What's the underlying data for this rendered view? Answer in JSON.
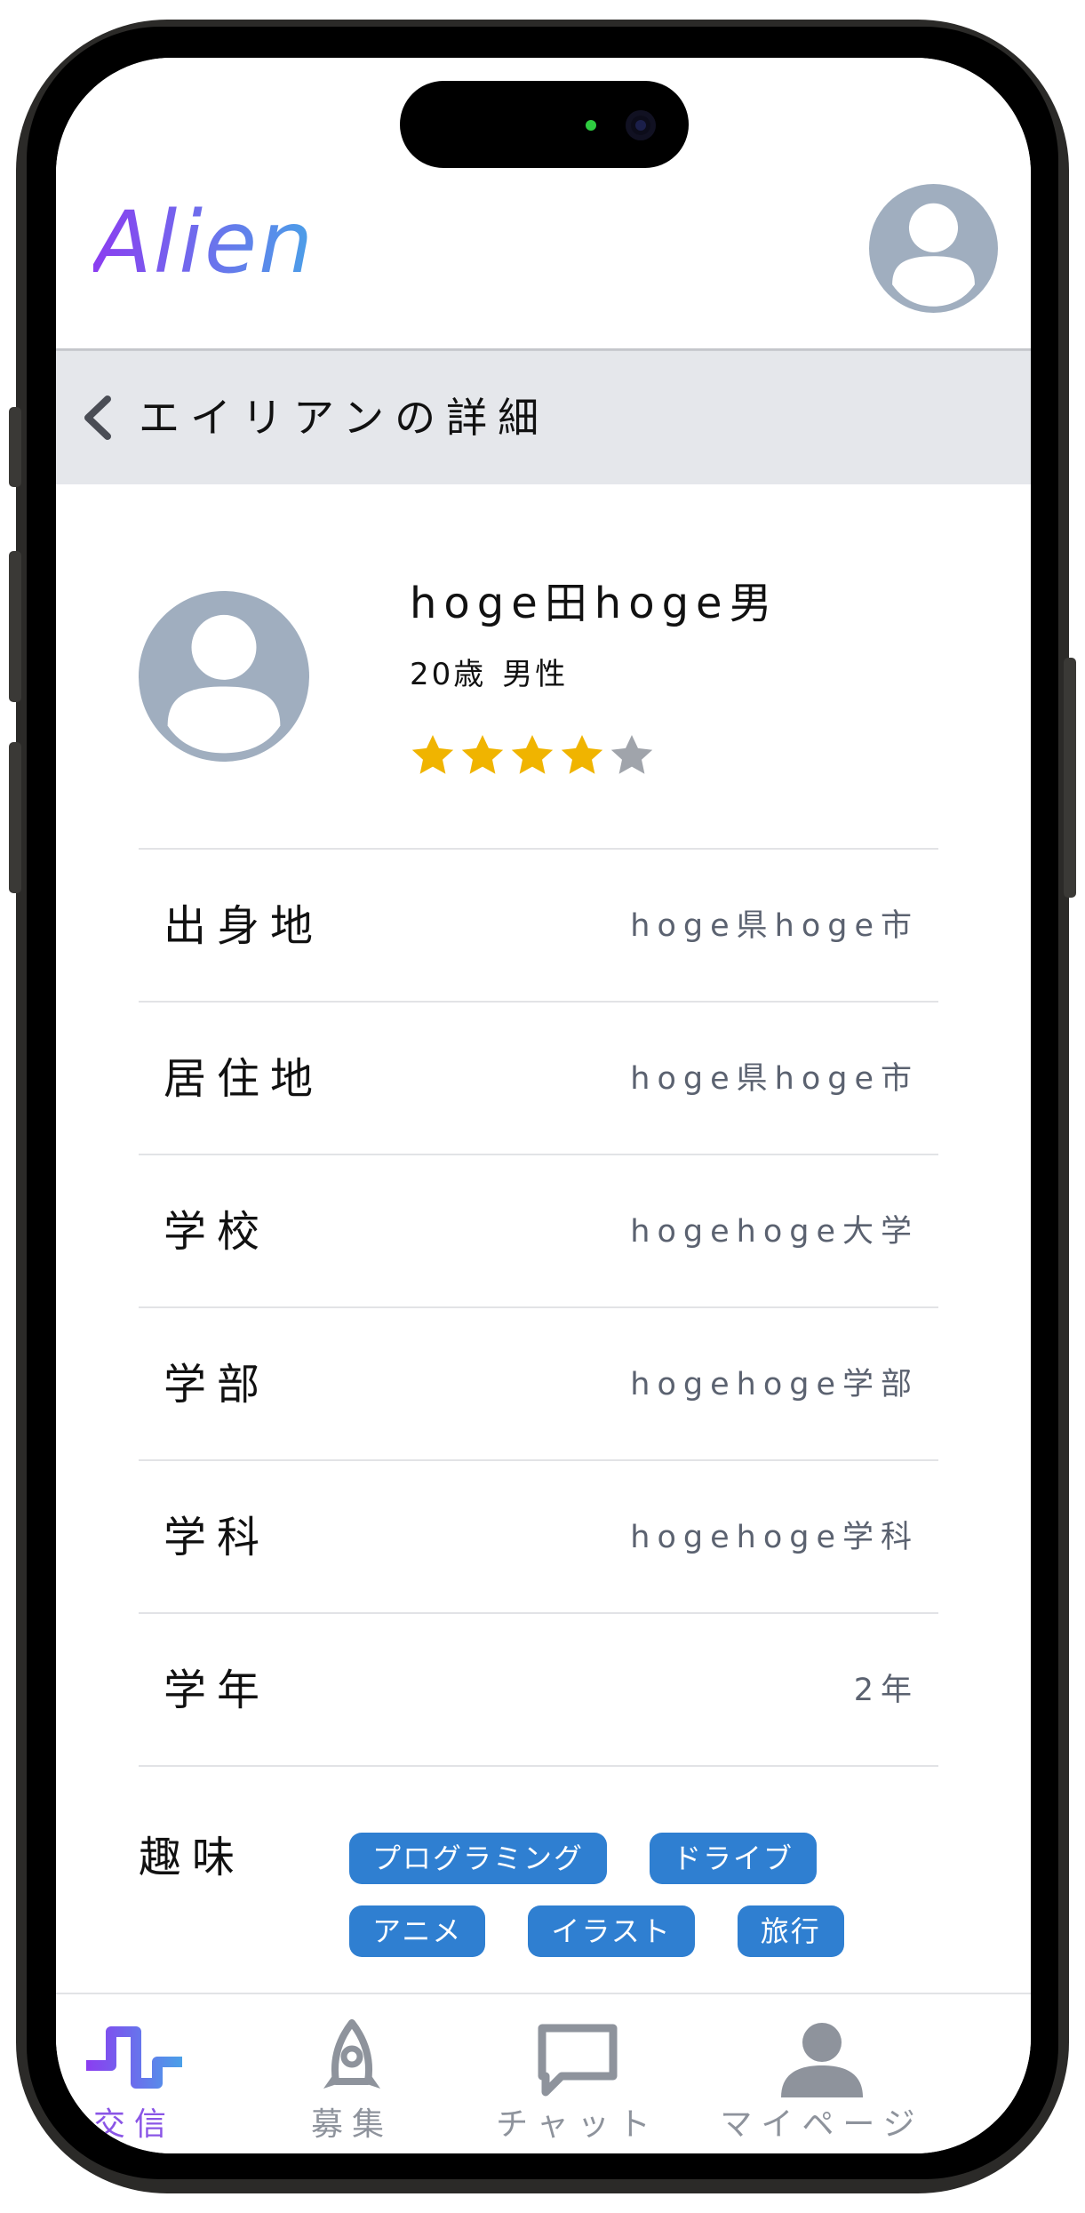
{
  "header": {
    "logo": "Alien",
    "avatar_icon": "user-avatar-icon"
  },
  "titlebar": {
    "back_icon": "chevron-left-icon",
    "title": "エイリアンの詳細"
  },
  "profile": {
    "name": "hoge田hoge男",
    "age": "20歳",
    "gender": "男性",
    "rating": 4,
    "rating_max": 5,
    "colors": {
      "star_filled": "#f0b400",
      "star_empty": "#a0a4ab"
    }
  },
  "info": [
    {
      "label": "出身地",
      "value": "hoge県hoge市"
    },
    {
      "label": "居住地",
      "value": "hoge県hoge市"
    },
    {
      "label": "学校",
      "value": "hogehoge大学"
    },
    {
      "label": "学部",
      "value": "hogehoge学部"
    },
    {
      "label": "学科",
      "value": "hogehoge学科"
    },
    {
      "label": "学年",
      "value": "2年"
    }
  ],
  "hobbies": {
    "label": "趣味",
    "tags": [
      "プログラミング",
      "ドライブ",
      "アニメ",
      "イラスト",
      "旅行"
    ],
    "tag_color": "#2f7fd1"
  },
  "tabbar": {
    "items": [
      {
        "label": "交信",
        "icon": "signal-wave-icon",
        "active": true
      },
      {
        "label": "募集",
        "icon": "rocket-icon",
        "active": false
      },
      {
        "label": "チャット",
        "icon": "chat-bubble-icon",
        "active": false
      },
      {
        "label": "マイページ",
        "icon": "person-icon",
        "active": false
      }
    ],
    "active_color": "#8a55e6",
    "inactive_color": "#8e939c"
  }
}
